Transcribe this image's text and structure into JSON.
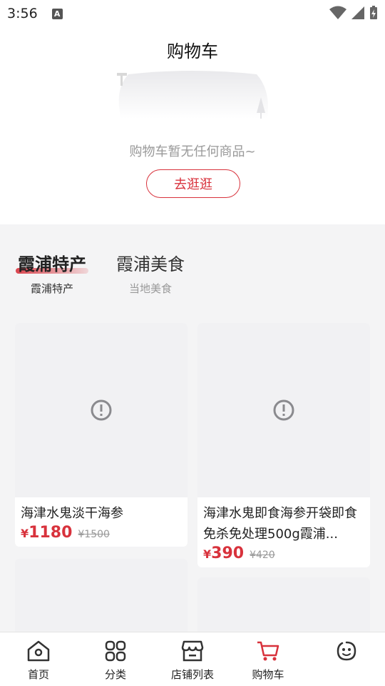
{
  "status": {
    "time": "3:56",
    "notif_letter": "A"
  },
  "header": {
    "title": "购物车"
  },
  "empty_state": {
    "message": "购物车暂无任何商品~",
    "button_label": "去逛逛"
  },
  "tabs": [
    {
      "title": "霞浦特产",
      "subtitle": "霞浦特产",
      "active": true
    },
    {
      "title": "霞浦美食",
      "subtitle": "当地美食",
      "active": false
    }
  ],
  "products": [
    {
      "name": "海津水鬼淡干海参",
      "currency": "¥",
      "price": "1180",
      "original_price": "¥1500"
    },
    {
      "name": "海津水鬼即食海参开袋即食免杀免处理500g霞浦...",
      "currency": "¥",
      "price": "390",
      "original_price": "¥420"
    }
  ],
  "bottom_nav": [
    {
      "label": "首页",
      "icon": "home-icon"
    },
    {
      "label": "分类",
      "icon": "grid-icon"
    },
    {
      "label": "店铺列表",
      "icon": "store-icon"
    },
    {
      "label": "购物车",
      "icon": "cart-icon",
      "active": true
    },
    {
      "label": "",
      "icon": "face-icon"
    }
  ],
  "colors": {
    "accent": "#d8323c",
    "background": "#f4f4f5"
  }
}
